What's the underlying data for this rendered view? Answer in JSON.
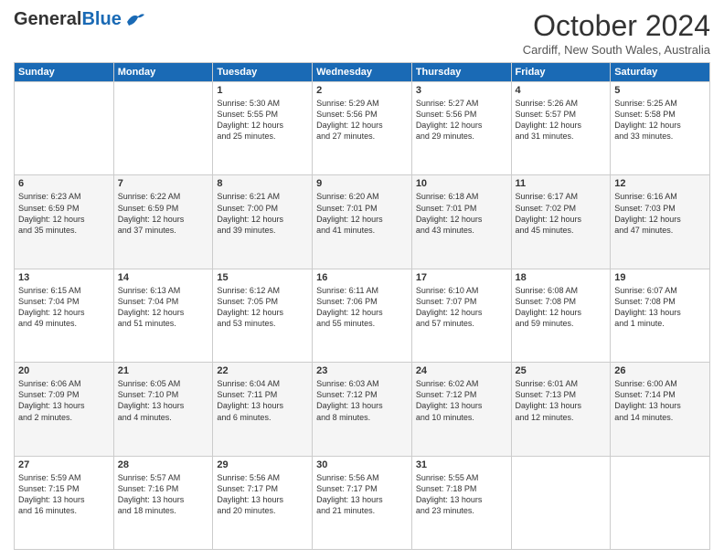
{
  "header": {
    "logo_general": "General",
    "logo_blue": "Blue",
    "month": "October 2024",
    "location": "Cardiff, New South Wales, Australia"
  },
  "days_of_week": [
    "Sunday",
    "Monday",
    "Tuesday",
    "Wednesday",
    "Thursday",
    "Friday",
    "Saturday"
  ],
  "weeks": [
    [
      {
        "day": "",
        "content": ""
      },
      {
        "day": "",
        "content": ""
      },
      {
        "day": "1",
        "content": "Sunrise: 5:30 AM\nSunset: 5:55 PM\nDaylight: 12 hours\nand 25 minutes."
      },
      {
        "day": "2",
        "content": "Sunrise: 5:29 AM\nSunset: 5:56 PM\nDaylight: 12 hours\nand 27 minutes."
      },
      {
        "day": "3",
        "content": "Sunrise: 5:27 AM\nSunset: 5:56 PM\nDaylight: 12 hours\nand 29 minutes."
      },
      {
        "day": "4",
        "content": "Sunrise: 5:26 AM\nSunset: 5:57 PM\nDaylight: 12 hours\nand 31 minutes."
      },
      {
        "day": "5",
        "content": "Sunrise: 5:25 AM\nSunset: 5:58 PM\nDaylight: 12 hours\nand 33 minutes."
      }
    ],
    [
      {
        "day": "6",
        "content": "Sunrise: 6:23 AM\nSunset: 6:59 PM\nDaylight: 12 hours\nand 35 minutes."
      },
      {
        "day": "7",
        "content": "Sunrise: 6:22 AM\nSunset: 6:59 PM\nDaylight: 12 hours\nand 37 minutes."
      },
      {
        "day": "8",
        "content": "Sunrise: 6:21 AM\nSunset: 7:00 PM\nDaylight: 12 hours\nand 39 minutes."
      },
      {
        "day": "9",
        "content": "Sunrise: 6:20 AM\nSunset: 7:01 PM\nDaylight: 12 hours\nand 41 minutes."
      },
      {
        "day": "10",
        "content": "Sunrise: 6:18 AM\nSunset: 7:01 PM\nDaylight: 12 hours\nand 43 minutes."
      },
      {
        "day": "11",
        "content": "Sunrise: 6:17 AM\nSunset: 7:02 PM\nDaylight: 12 hours\nand 45 minutes."
      },
      {
        "day": "12",
        "content": "Sunrise: 6:16 AM\nSunset: 7:03 PM\nDaylight: 12 hours\nand 47 minutes."
      }
    ],
    [
      {
        "day": "13",
        "content": "Sunrise: 6:15 AM\nSunset: 7:04 PM\nDaylight: 12 hours\nand 49 minutes."
      },
      {
        "day": "14",
        "content": "Sunrise: 6:13 AM\nSunset: 7:04 PM\nDaylight: 12 hours\nand 51 minutes."
      },
      {
        "day": "15",
        "content": "Sunrise: 6:12 AM\nSunset: 7:05 PM\nDaylight: 12 hours\nand 53 minutes."
      },
      {
        "day": "16",
        "content": "Sunrise: 6:11 AM\nSunset: 7:06 PM\nDaylight: 12 hours\nand 55 minutes."
      },
      {
        "day": "17",
        "content": "Sunrise: 6:10 AM\nSunset: 7:07 PM\nDaylight: 12 hours\nand 57 minutes."
      },
      {
        "day": "18",
        "content": "Sunrise: 6:08 AM\nSunset: 7:08 PM\nDaylight: 12 hours\nand 59 minutes."
      },
      {
        "day": "19",
        "content": "Sunrise: 6:07 AM\nSunset: 7:08 PM\nDaylight: 13 hours\nand 1 minute."
      }
    ],
    [
      {
        "day": "20",
        "content": "Sunrise: 6:06 AM\nSunset: 7:09 PM\nDaylight: 13 hours\nand 2 minutes."
      },
      {
        "day": "21",
        "content": "Sunrise: 6:05 AM\nSunset: 7:10 PM\nDaylight: 13 hours\nand 4 minutes."
      },
      {
        "day": "22",
        "content": "Sunrise: 6:04 AM\nSunset: 7:11 PM\nDaylight: 13 hours\nand 6 minutes."
      },
      {
        "day": "23",
        "content": "Sunrise: 6:03 AM\nSunset: 7:12 PM\nDaylight: 13 hours\nand 8 minutes."
      },
      {
        "day": "24",
        "content": "Sunrise: 6:02 AM\nSunset: 7:12 PM\nDaylight: 13 hours\nand 10 minutes."
      },
      {
        "day": "25",
        "content": "Sunrise: 6:01 AM\nSunset: 7:13 PM\nDaylight: 13 hours\nand 12 minutes."
      },
      {
        "day": "26",
        "content": "Sunrise: 6:00 AM\nSunset: 7:14 PM\nDaylight: 13 hours\nand 14 minutes."
      }
    ],
    [
      {
        "day": "27",
        "content": "Sunrise: 5:59 AM\nSunset: 7:15 PM\nDaylight: 13 hours\nand 16 minutes."
      },
      {
        "day": "28",
        "content": "Sunrise: 5:57 AM\nSunset: 7:16 PM\nDaylight: 13 hours\nand 18 minutes."
      },
      {
        "day": "29",
        "content": "Sunrise: 5:56 AM\nSunset: 7:17 PM\nDaylight: 13 hours\nand 20 minutes."
      },
      {
        "day": "30",
        "content": "Sunrise: 5:56 AM\nSunset: 7:17 PM\nDaylight: 13 hours\nand 21 minutes."
      },
      {
        "day": "31",
        "content": "Sunrise: 5:55 AM\nSunset: 7:18 PM\nDaylight: 13 hours\nand 23 minutes."
      },
      {
        "day": "",
        "content": ""
      },
      {
        "day": "",
        "content": ""
      }
    ]
  ]
}
